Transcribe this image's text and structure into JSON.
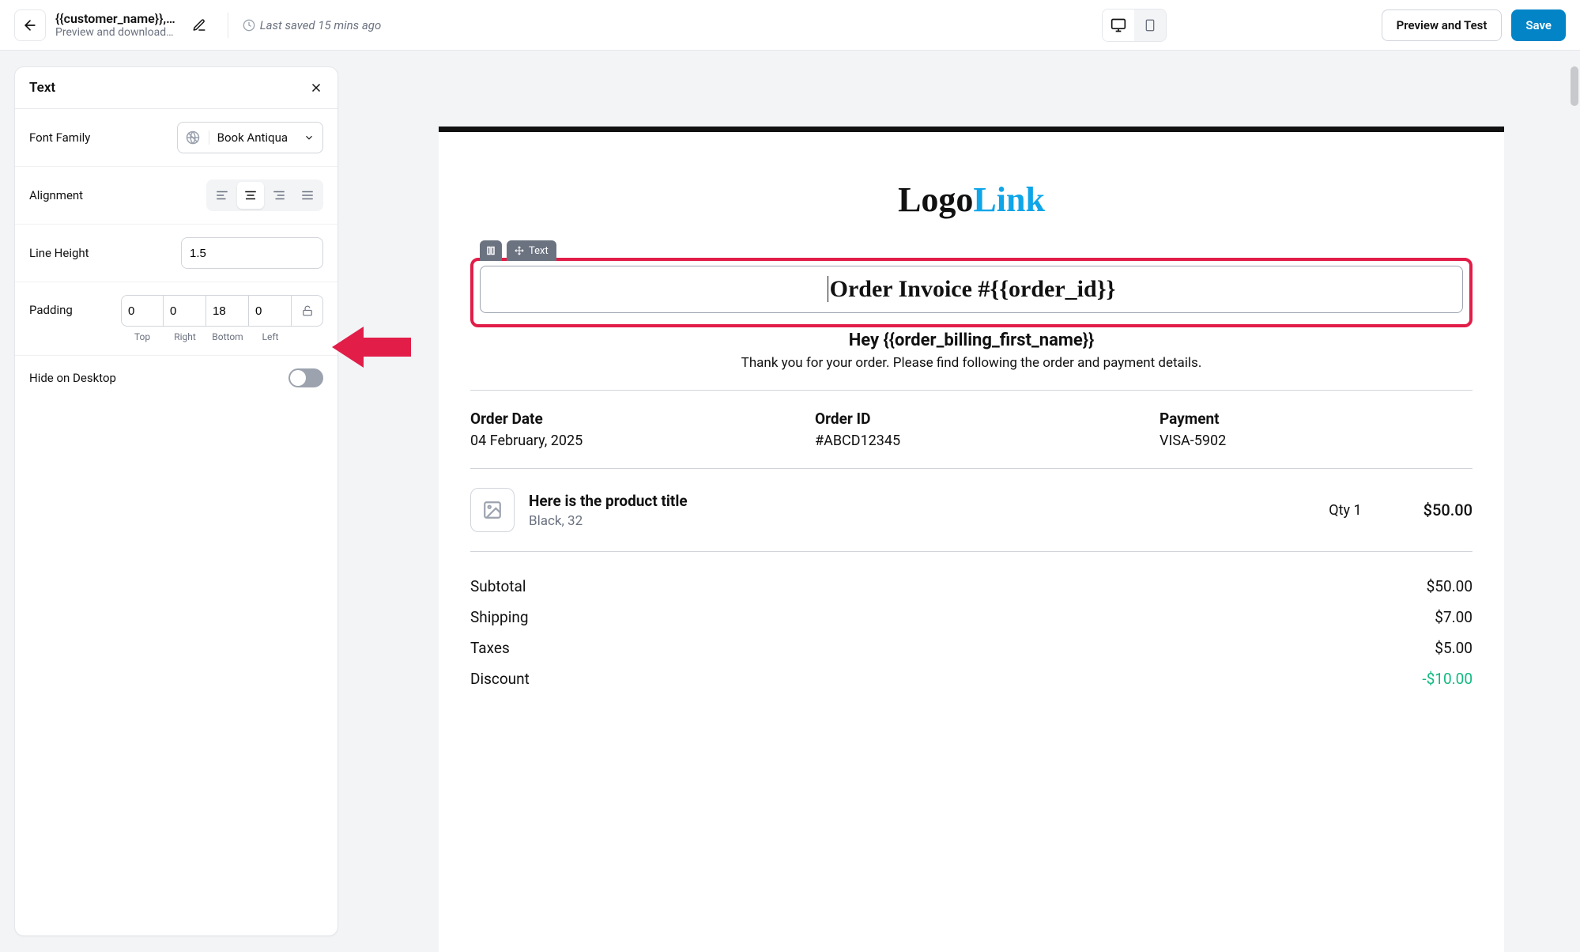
{
  "header": {
    "title": "{{customer_name}},…",
    "subtitle": "Preview and download…",
    "last_saved": "Last saved 15 mins ago",
    "preview_test_label": "Preview and Test",
    "save_label": "Save"
  },
  "panel": {
    "title": "Text",
    "font_family_label": "Font Family",
    "font_family_value": "Book Antiqua",
    "alignment_label": "Alignment",
    "alignment_value": "center",
    "line_height_label": "Line Height",
    "line_height_value": "1.5",
    "padding_label": "Padding",
    "padding": {
      "top": "0",
      "right": "0",
      "bottom": "18",
      "left": "0"
    },
    "padding_labels": {
      "top": "Top",
      "right": "Right",
      "bottom": "Bottom",
      "left": "Left"
    },
    "hide_desktop_label": "Hide on Desktop",
    "hide_desktop_value": false
  },
  "canvas": {
    "logo_part1": "Logo",
    "logo_part2": "Link",
    "badge_text": "Text",
    "heading": "Order Invoice #{{order_id}}",
    "greeting": "Hey {{order_billing_first_name}}",
    "sub": "Thank you for your order. Please find following the order and payment details.",
    "meta": {
      "order_date_label": "Order Date",
      "order_date_value": "04 February, 2025",
      "order_id_label": "Order ID",
      "order_id_value": "#ABCD12345",
      "payment_label": "Payment",
      "payment_value": "VISA-5902"
    },
    "product": {
      "title": "Here is the product title",
      "variant": "Black, 32",
      "qty": "Qty 1",
      "price": "$50.00"
    },
    "totals": {
      "subtotal_label": "Subtotal",
      "subtotal_value": "$50.00",
      "shipping_label": "Shipping",
      "shipping_value": "$7.00",
      "taxes_label": "Taxes",
      "taxes_value": "$5.00",
      "discount_label": "Discount",
      "discount_value": "-$10.00"
    }
  }
}
